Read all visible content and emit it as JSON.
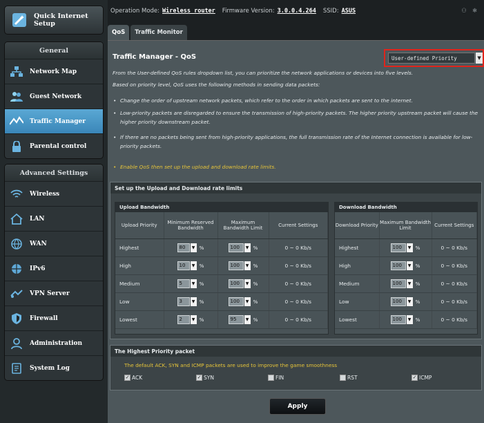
{
  "status": {
    "op_label": "Operation Mode:",
    "op_value": "Wireless router",
    "fw_label": "Firmware Version:",
    "fw_value": "3.0.0.4.264",
    "ssid_label": "SSID:",
    "ssid_value": "ASUS"
  },
  "sidebar": {
    "qis": "Quick Internet Setup",
    "general_header": "General",
    "general": [
      {
        "label": "Network Map",
        "icon": "network-map-icon"
      },
      {
        "label": "Guest Network",
        "icon": "guest-network-icon"
      },
      {
        "label": "Traffic Manager",
        "icon": "traffic-manager-icon",
        "active": true
      },
      {
        "label": "Parental control",
        "icon": "lock-icon"
      }
    ],
    "advanced_header": "Advanced Settings",
    "advanced": [
      {
        "label": "Wireless",
        "icon": "wifi-icon"
      },
      {
        "label": "LAN",
        "icon": "home-icon"
      },
      {
        "label": "WAN",
        "icon": "globe-icon"
      },
      {
        "label": "IPv6",
        "icon": "ipv6-icon"
      },
      {
        "label": "VPN Server",
        "icon": "vpn-icon"
      },
      {
        "label": "Firewall",
        "icon": "shield-icon"
      },
      {
        "label": "Administration",
        "icon": "admin-icon"
      },
      {
        "label": "System Log",
        "icon": "log-icon"
      }
    ]
  },
  "tabs": [
    "QoS",
    "Traffic Monitor"
  ],
  "main": {
    "title": "Traffic Manager - QoS",
    "priority_select": "User-defined Priority",
    "desc": [
      "From the User-defined QoS rules dropdown list, you can prioritize the network applications or devices into five levels.",
      "Based on priority level, QoS uses the following methods in sending data packets:"
    ],
    "bullets": [
      "Change the order of upstream network packets, which refer to the order in which packets are sent to the internet.",
      "Low-priority packets are disregarded to ensure the transmission of high-priority packets. The higher priority upstream packet will cause the higher priority downstream packet.",
      "If there are no packets being sent from high-priority applications, the full transmission rate of the Internet connection is available for low-priority packets."
    ],
    "enable_note": "Enable QoS then set up the upload and download rate limits."
  },
  "rate": {
    "section_title": "Set up the Upload and Download rate limits",
    "upload_title": "Upload Bandwidth",
    "download_title": "Download Bandwidth",
    "up_cols": [
      "Upload Priority",
      "Minimum Reserved Bandwidth",
      "Maximum Bandwidth Limit",
      "Current Settings"
    ],
    "down_cols": [
      "Download Priority",
      "Maximum Bandwidth Limit",
      "Current Settings"
    ],
    "rows": [
      {
        "name": "Highest",
        "min": "80",
        "max": "100",
        "cur": "0 ~ 0 Kb/s",
        "dmax": "100",
        "dcur": "0 ~ 0 Kb/s"
      },
      {
        "name": "High",
        "min": "10",
        "max": "100",
        "cur": "0 ~ 0 Kb/s",
        "dmax": "100",
        "dcur": "0 ~ 0 Kb/s"
      },
      {
        "name": "Medium",
        "min": "5",
        "max": "100",
        "cur": "0 ~ 0 Kb/s",
        "dmax": "100",
        "dcur": "0 ~ 0 Kb/s"
      },
      {
        "name": "Low",
        "min": "3",
        "max": "100",
        "cur": "0 ~ 0 Kb/s",
        "dmax": "100",
        "dcur": "0 ~ 0 Kb/s"
      },
      {
        "name": "Lowest",
        "min": "2",
        "max": "95",
        "cur": "0 ~ 0 Kb/s",
        "dmax": "100",
        "dcur": "0 ~ 0 Kb/s"
      }
    ],
    "pct": "%"
  },
  "packet": {
    "section_title": "The Highest Priority packet",
    "note": "The default ACK, SYN and ICMP packets are used to improve the game smoothness",
    "checks": [
      {
        "label": "ACK",
        "checked": true
      },
      {
        "label": "SYN",
        "checked": true
      },
      {
        "label": "FIN",
        "checked": false
      },
      {
        "label": "RST",
        "checked": false
      },
      {
        "label": "ICMP",
        "checked": true
      }
    ]
  },
  "apply_label": "Apply",
  "colors": {
    "active": "#3f8fc1",
    "highlight": "#e0241b",
    "note": "#e6c43a"
  }
}
